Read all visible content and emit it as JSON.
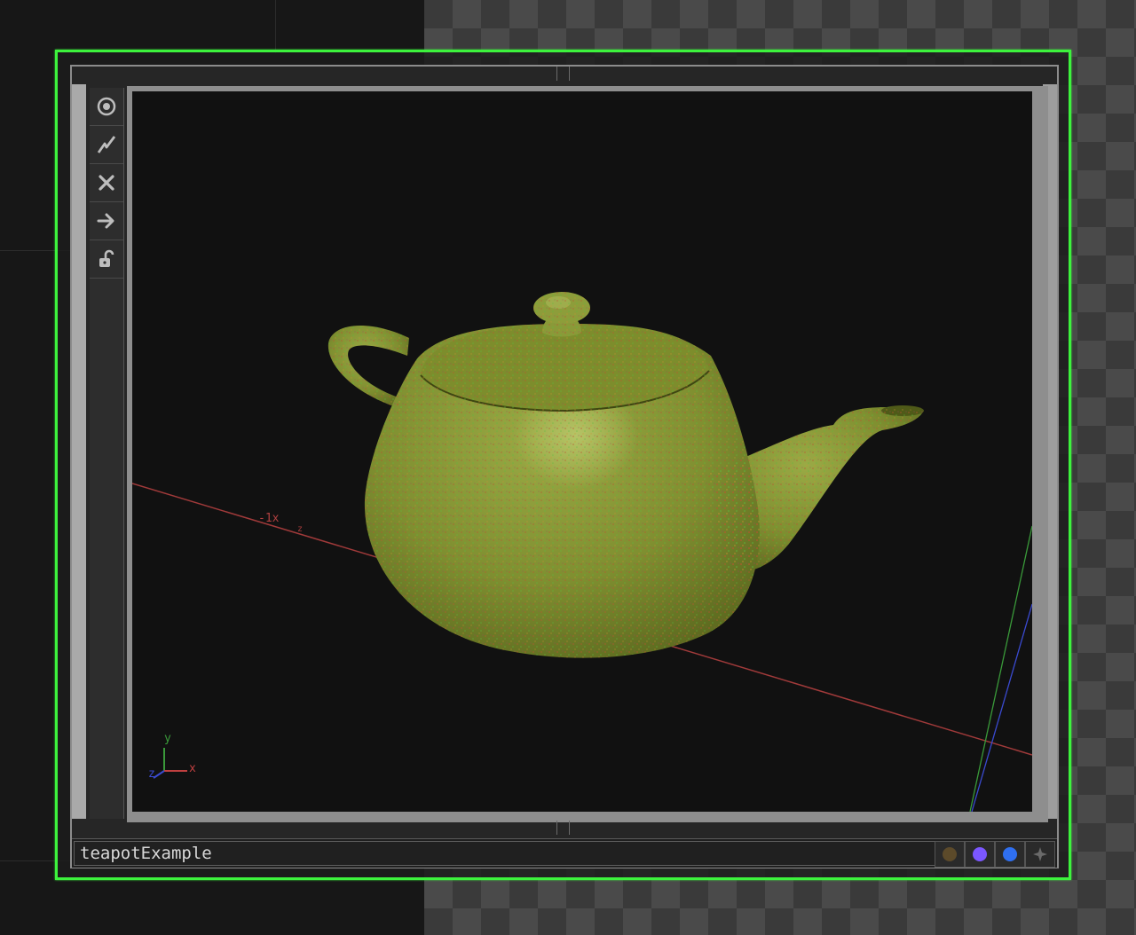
{
  "node": {
    "name": "teapotExample"
  },
  "toolbar": {
    "buttons": [
      {
        "icon": "target-icon"
      },
      {
        "icon": "bypass-icon"
      },
      {
        "icon": "close-icon"
      },
      {
        "icon": "arrow-right-icon"
      },
      {
        "icon": "unlock-icon"
      }
    ]
  },
  "viewport": {
    "axis_marker_label": "-1x",
    "gizmo": {
      "x": "x",
      "y": "y",
      "z": "z"
    }
  },
  "flags": [
    {
      "icon": "display-flag-icon",
      "color": "#5c4a2a"
    },
    {
      "icon": "render-flag-icon",
      "color": "#7b57ff"
    },
    {
      "icon": "viewer-flag-icon",
      "color": "#2f6ff0"
    },
    {
      "icon": "expand-icon",
      "color": "#6a6a6a"
    }
  ],
  "colors": {
    "selection": "#3df23d",
    "teapot": "#8a9a3a",
    "x_axis": "#b04040",
    "y_axis": "#3a9a3a",
    "z_axis": "#3a4ad0"
  }
}
